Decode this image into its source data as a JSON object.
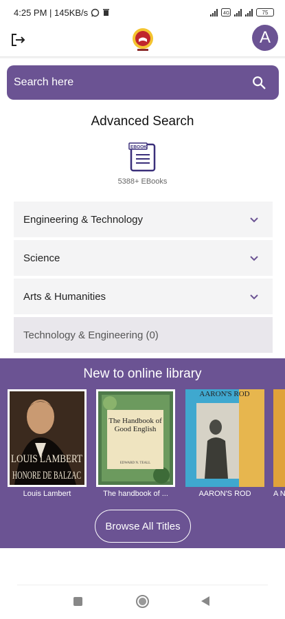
{
  "status_bar": {
    "time_net": "4:25 PM | 145KB/s",
    "battery": "75"
  },
  "header": {
    "logout_icon": "logout-icon",
    "avatar_letter": "A"
  },
  "search": {
    "placeholder": "Search here"
  },
  "advanced_search": {
    "title": "Advanced Search",
    "ebook_icon_label": "EBOOK",
    "ebook_count": "5388+ EBooks"
  },
  "categories": [
    {
      "label": "Engineering & Technology"
    },
    {
      "label": "Science"
    },
    {
      "label": "Arts & Humanities"
    }
  ],
  "sub_category": "Technology & Engineering (0)",
  "new_to_library": {
    "title": "New to online library",
    "books": [
      {
        "title": "Louis Lambert",
        "cover_text_1": "LOUIS LAMBERT",
        "cover_text_2": "HONORE DE BALZAC"
      },
      {
        "title": "The handbook of ...",
        "cover_text_1": "The Handbook of Good English",
        "cover_text_2": "EDWARD N. TEALL"
      },
      {
        "title": "AARON'S ROD",
        "cover_text_1": "AARON'S ROD"
      },
      {
        "title": "A N"
      }
    ],
    "browse_label": "Browse All Titles"
  },
  "colors": {
    "accent": "#6b5393",
    "category_bg": "#f4f4f5",
    "subcategory_bg": "#e9e7ec"
  }
}
